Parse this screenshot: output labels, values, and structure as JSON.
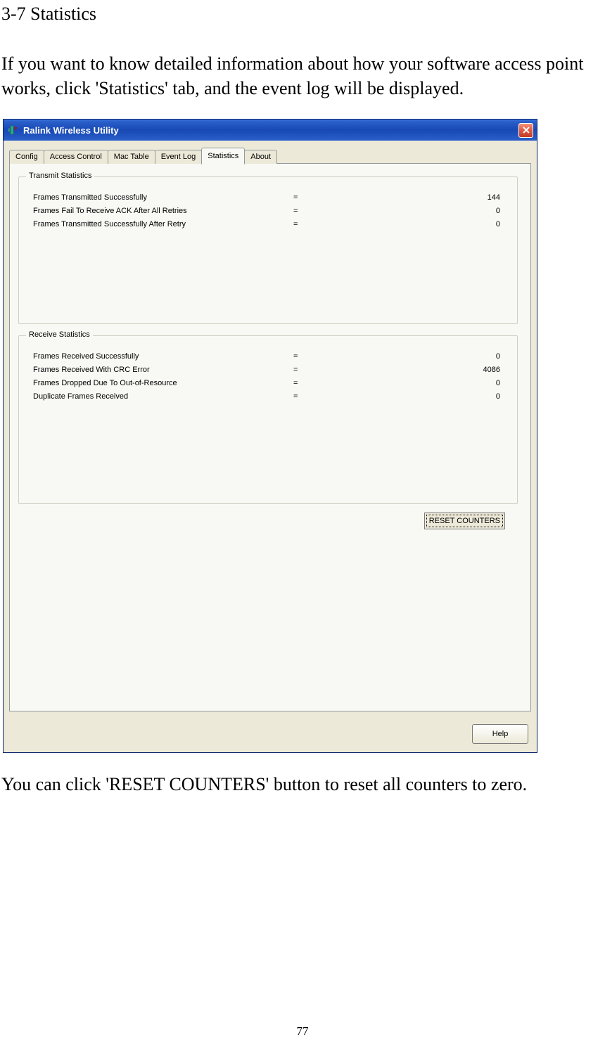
{
  "doc": {
    "heading": "3-7 Statistics",
    "intro": "If you want to know detailed information about how your software access point works, click 'Statistics' tab, and the event log will be displayed.",
    "footer": "You can click 'RESET COUNTERS' button to reset all counters to zero.",
    "page_number": "77"
  },
  "window": {
    "title": "Ralink Wireless Utility",
    "tabs": [
      "Config",
      "Access Control",
      "Mac Table",
      "Event Log",
      "Statistics",
      "About"
    ],
    "active_tab": "Statistics",
    "transmit": {
      "legend": "Transmit Statistics",
      "rows": [
        {
          "label": "Frames Transmitted Successfully",
          "eq": "=",
          "value": "144"
        },
        {
          "label": "Frames Fail To Receive ACK After All Retries",
          "eq": "=",
          "value": "0"
        },
        {
          "label": "Frames Transmitted Successfully After Retry",
          "eq": "=",
          "value": "0"
        }
      ]
    },
    "receive": {
      "legend": "Receive Statistics",
      "rows": [
        {
          "label": "Frames Received Successfully",
          "eq": "=",
          "value": "0"
        },
        {
          "label": "Frames Received With CRC Error",
          "eq": "=",
          "value": "4086"
        },
        {
          "label": "Frames Dropped Due To Out-of-Resource",
          "eq": "=",
          "value": "0"
        },
        {
          "label": "Duplicate Frames Received",
          "eq": "=",
          "value": "0"
        }
      ]
    },
    "reset_label": "RESET COUNTERS",
    "help_label": "Help"
  }
}
